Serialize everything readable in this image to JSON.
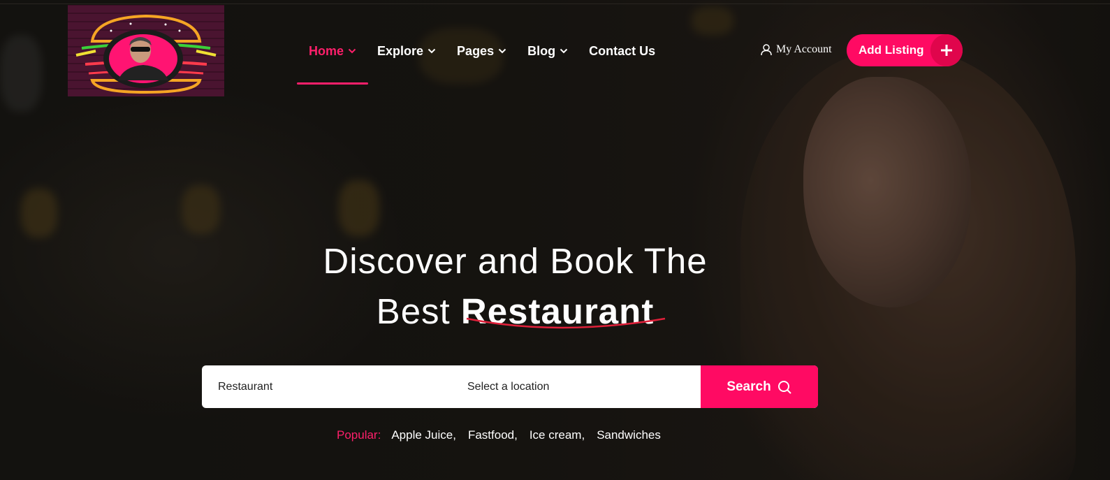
{
  "header": {
    "logo_icon": "burger-neon-logo",
    "nav": [
      {
        "label": "Home",
        "active": true,
        "has_dropdown": true
      },
      {
        "label": "Explore",
        "active": false,
        "has_dropdown": true
      },
      {
        "label": "Pages",
        "active": false,
        "has_dropdown": true
      },
      {
        "label": "Blog",
        "active": false,
        "has_dropdown": true
      },
      {
        "label": "Contact Us",
        "active": false,
        "has_dropdown": false
      }
    ],
    "account_label": "My Account",
    "account_icon": "user-icon",
    "add_listing_label": "Add Listing",
    "add_listing_icon": "plus-icon"
  },
  "hero": {
    "headline_line1": "Discover and Book The",
    "headline_line2_prefix": "Best",
    "headline_line2_bold": "Restaurant"
  },
  "search": {
    "keyword_value": "Restaurant",
    "location_value": "Select a location",
    "button_label": "Search",
    "button_icon": "search-icon"
  },
  "popular": {
    "label": "Popular:",
    "tags": [
      "Apple Juice,",
      "Fastfood,",
      "Ice cream,",
      "Sandwiches"
    ]
  },
  "colors": {
    "accent": "#ff0a63",
    "active_nav": "#ff1f6b",
    "background": "#141210"
  }
}
